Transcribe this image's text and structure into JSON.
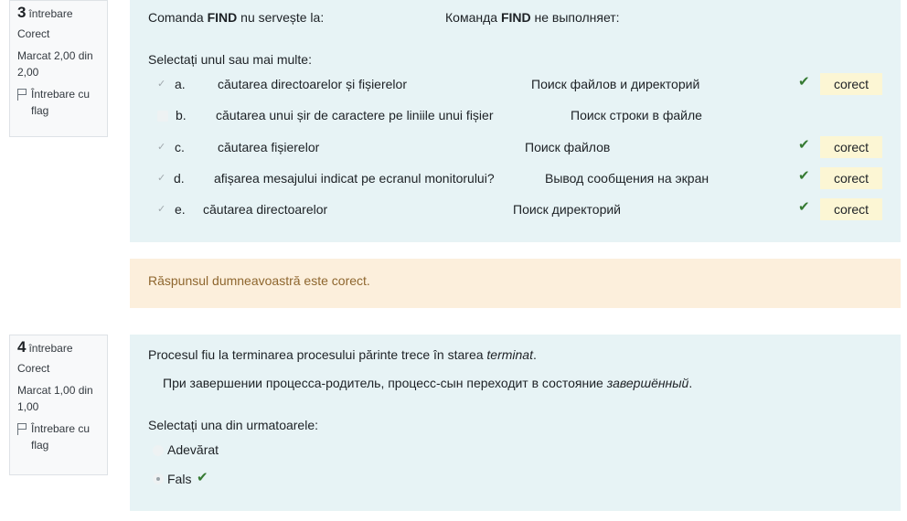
{
  "q3": {
    "info": {
      "number": "3",
      "question_word": "întrebare",
      "state": "Corect",
      "grade": "Marcat 2,00 din 2,00",
      "flag_label": "Întrebare cu flag"
    },
    "prompt_ro": "Comanda FIND nu servește la:",
    "prompt_ro_pre": "Comanda",
    "prompt_ro_bold": "FIND",
    "prompt_ro_post": "nu servește la:",
    "prompt_ru_pre": "Команда",
    "prompt_ru_bold": "FIND",
    "prompt_ru_post": "не выполняет:",
    "select_instruction": "Selectați unul sau mai multe:",
    "options": [
      {
        "letter": "a.",
        "ro": "căutarea directoarelor și fișierelor",
        "ru": "Поиск файлов и директорий",
        "checked": true,
        "feedback": "corect"
      },
      {
        "letter": "b.",
        "ro": "căutarea unui șir de caractere pe liniile unui fișier",
        "ru": "Поиск строки в файле",
        "checked": false,
        "feedback": ""
      },
      {
        "letter": "c.",
        "ro": "căutarea fișierelor",
        "ru": "Поиск файлов",
        "checked": true,
        "feedback": "corect"
      },
      {
        "letter": "d.",
        "ro": "afișarea mesajului indicat pe ecranul monitorului?",
        "ru": "Вывод сообщения на экран",
        "checked": true,
        "feedback": "corect"
      },
      {
        "letter": "e.",
        "ro": "căutarea directoarelor",
        "ru": "Поиск директорий",
        "checked": true,
        "feedback": "corect"
      }
    ],
    "general_feedback": "Răspunsul dumneavoastră este corect."
  },
  "q4": {
    "info": {
      "number": "4",
      "question_word": "întrebare",
      "state": "Corect",
      "grade": "Marcat 1,00 din 1,00",
      "flag_label": "Întrebare cu flag"
    },
    "prompt_ro_pre": "Procesul fiu la terminarea procesului părinte trece  în starea",
    "prompt_ro_em": "terminat",
    "prompt_ro_post": ".",
    "prompt_ru_pre": "При завершении процесса-родитель, процесс-сын переходит в состояние",
    "prompt_ru_em": "завершённый",
    "prompt_ru_post": ".",
    "select_instruction": "Selectați una din urmatoarele:",
    "options": [
      {
        "label": "Adevărat",
        "selected": false
      },
      {
        "label": "Fals",
        "selected": true
      }
    ]
  },
  "icons": {
    "check": "check-icon",
    "flag": "flag-icon"
  },
  "colors": {
    "content_bg": "#e7f3f5",
    "feedback_bg": "#fcefdc",
    "feedback_text": "#8e662e",
    "correct_badge_bg": "#fcf6d4",
    "check_green": "#357a32"
  }
}
